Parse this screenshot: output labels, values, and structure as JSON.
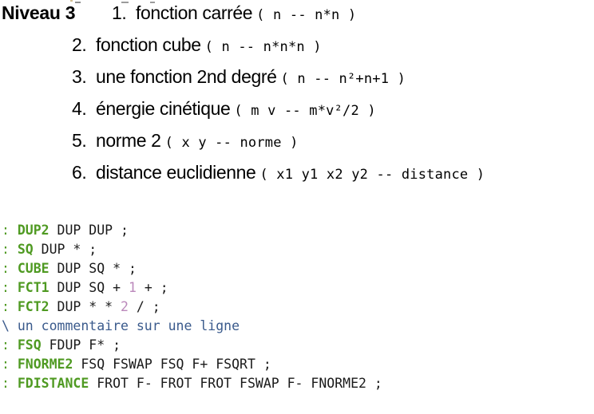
{
  "slide": {
    "title": "Niveau 3",
    "exercises": [
      {
        "num": "1.",
        "label": "fonction carrée",
        "stack": "( n -- n*n )"
      },
      {
        "num": "2.",
        "label": "fonction cube",
        "stack": "( n -- n*n*n )"
      },
      {
        "num": "3.",
        "label": "une fonction 2nd degré",
        "stack": "( n -- n²+n+1 )"
      },
      {
        "num": "4.",
        "label": "énergie cinétique",
        "stack": "( m v -- m*v²/2 )"
      },
      {
        "num": "5.",
        "label": "norme 2",
        "stack": "( x y -- norme )"
      },
      {
        "num": "6.",
        "label": "distance euclidienne",
        "stack": "( x1 y1 x2 y2 -- distance )"
      }
    ]
  },
  "code": {
    "language": "forth",
    "colors": {
      "definition": "#4f9a22",
      "word_name": "#4f9a22",
      "number": "#bb88bb",
      "comment": "#3a5a8c",
      "body": "#1a1a1a",
      "background": "#ffffff"
    },
    "lines": [
      {
        "colon": ":",
        "name": "DUP2",
        "body": " DUP DUP ;"
      },
      {
        "colon": ":",
        "name": "SQ",
        "body": " DUP * ;"
      },
      {
        "colon": ":",
        "name": "CUBE",
        "body": " DUP SQ * ;"
      },
      {
        "colon": ":",
        "name": "FCT1",
        "body": " DUP SQ + ",
        "number": "1",
        "body2": " + ;"
      },
      {
        "colon": ":",
        "name": "FCT2",
        "body": " DUP * * ",
        "number": "2",
        "body2": " / ;"
      },
      {
        "comment": "\\ un commentaire sur une ligne"
      },
      {
        "colon": ":",
        "name": "FSQ",
        "body": " FDUP F* ;"
      },
      {
        "colon": ":",
        "name": "FNORME2",
        "body": " FSQ FSWAP FSQ F+ FSQRT ;"
      },
      {
        "colon": ":",
        "name": "FDISTANCE",
        "body": " FROT F- FROT FROT FSWAP F- FNORME2 ;"
      }
    ]
  }
}
